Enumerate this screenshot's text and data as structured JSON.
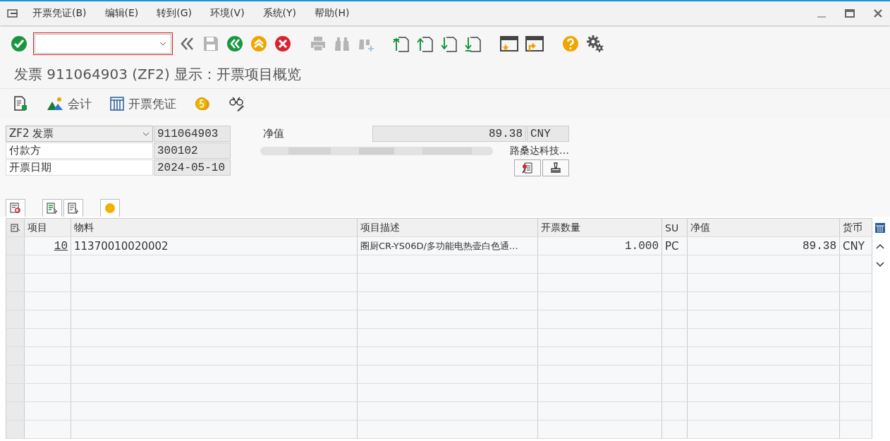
{
  "menu": [
    "开票凭证(B)",
    "编辑(E)",
    "转到(G)",
    "环境(V)",
    "系统(Y)",
    "帮助(H)"
  ],
  "toolbar": [
    {
      "kind": "enter",
      "disabled": false
    },
    {
      "kind": "back-double",
      "disabled": false
    },
    {
      "kind": "save",
      "disabled": true
    },
    {
      "kind": "back",
      "disabled": false
    },
    {
      "kind": "exit",
      "disabled": false
    },
    {
      "kind": "cancel",
      "disabled": false
    },
    {
      "kind": "print",
      "disabled": true
    },
    {
      "kind": "find",
      "disabled": true
    },
    {
      "kind": "find-next",
      "disabled": true
    },
    {
      "kind": "first-page",
      "disabled": false
    },
    {
      "kind": "prev-page",
      "disabled": false
    },
    {
      "kind": "next-page",
      "disabled": false
    },
    {
      "kind": "last-page",
      "disabled": false
    },
    {
      "kind": "new-session",
      "disabled": false
    },
    {
      "kind": "shortcut",
      "disabled": false
    },
    {
      "kind": "help",
      "disabled": false
    },
    {
      "kind": "settings",
      "disabled": false
    }
  ],
  "title": "发票 911064903 (ZF2) 显示：开票项目概览",
  "app_toolbar": [
    {
      "kind": "document"
    },
    {
      "kind": "accounting",
      "label": "会计"
    },
    {
      "kind": "grid",
      "label": "开票凭证"
    },
    {
      "kind": "coin"
    },
    {
      "kind": "glasses"
    }
  ],
  "header": {
    "doc_type": "ZF2 发票",
    "doc_number": "911064903",
    "payer_label": "付款方",
    "payer": "300102",
    "date_label": "开票日期",
    "date": "2024-05-10",
    "net_label": "净值",
    "net_value": "89.38",
    "currency": "CNY",
    "payer_name": "路桑达科技…"
  },
  "table": {
    "columns": [
      "项目",
      "物料",
      "项目描述",
      "开票数量",
      "SU",
      "净值",
      "货币"
    ],
    "rows": [
      {
        "cells": [
          "10",
          "11370010020002",
          "圈厨CR-YS06D/多功能电热壶白色通…",
          "1.000",
          "PC",
          "89.38",
          "CNY"
        ],
        "selected": false
      }
    ]
  }
}
